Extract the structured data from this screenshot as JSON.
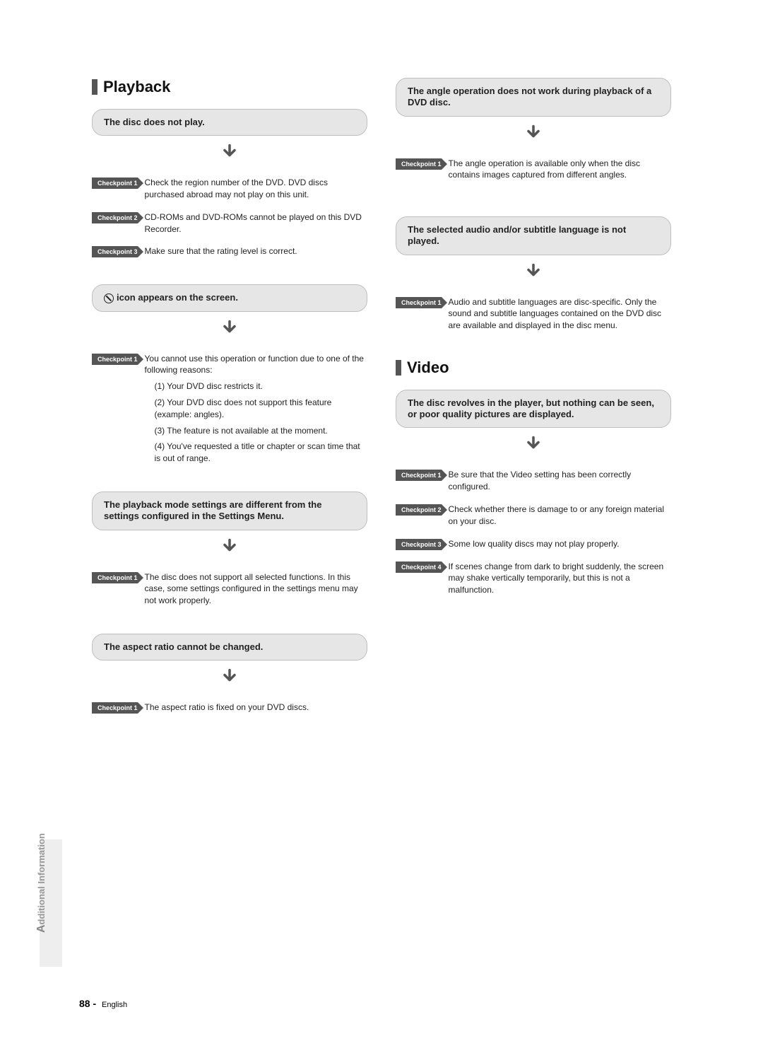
{
  "page_number": "88",
  "footer_language": "English",
  "sidebar_label_main": "dditional Information",
  "sidebar_label_cap": "A",
  "sections": {
    "playback": {
      "title": "Playback",
      "blocks": [
        {
          "key": "p1",
          "heading": "The disc does not play.",
          "checks": [
            {
              "label": "Checkpoint 1",
              "text": "Check the region number of the DVD. DVD discs purchased abroad may not play on this unit."
            },
            {
              "label": "Checkpoint 2",
              "text": "CD-ROMs and DVD-ROMs cannot be played on this DVD Recorder."
            },
            {
              "label": "Checkpoint 3",
              "text": "Make sure that the rating level is correct."
            }
          ]
        },
        {
          "key": "p2",
          "heading_icon": "prohibit",
          "heading": "icon appears on the screen.",
          "checks": [
            {
              "label": "Checkpoint 1",
              "text": "You cannot use this operation or function due to one of the following reasons:",
              "subs": [
                "(1) Your DVD disc restricts it.",
                "(2) Your DVD disc does not support this feature (example: angles).",
                "(3) The feature is not available at the moment.",
                "(4) You've requested a title or chapter or scan time that is out of range."
              ]
            }
          ]
        },
        {
          "key": "p3",
          "heading": "The playback mode settings are different from the settings configured in the Settings Menu.",
          "checks": [
            {
              "label": "Checkpoint 1",
              "text": "The disc does not support all selected functions. In this case, some settings configured in the settings menu may not work properly."
            }
          ]
        },
        {
          "key": "p4",
          "heading": "The aspect ratio cannot be changed.",
          "checks": [
            {
              "label": "Checkpoint 1",
              "text": "The aspect ratio is fixed on your DVD discs."
            }
          ]
        },
        {
          "key": "p5",
          "heading": "The angle operation does not work during playback of a DVD disc.",
          "checks": [
            {
              "label": "Checkpoint 1",
              "text": "The angle operation is available only when the disc contains images captured from different angles."
            }
          ]
        },
        {
          "key": "p6",
          "heading": "The selected audio and/or subtitle language is not played.",
          "checks": [
            {
              "label": "Checkpoint 1",
              "text": "Audio and subtitle languages are disc-specific. Only the sound and subtitle languages contained on the DVD disc are available and displayed in the disc menu."
            }
          ]
        }
      ]
    },
    "video": {
      "title": "Video",
      "blocks": [
        {
          "key": "v1",
          "heading": "The disc revolves in the player, but nothing can be seen, or poor quality pictures are displayed.",
          "checks": [
            {
              "label": "Checkpoint 1",
              "text": "Be sure that the Video setting has been correctly configured."
            },
            {
              "label": "Checkpoint 2",
              "text": "Check whether there is damage to or any foreign material on your disc."
            },
            {
              "label": "Checkpoint 3",
              "text": "Some low quality discs may not play properly."
            },
            {
              "label": "Checkpoint 4",
              "text": "If scenes change from dark to bright suddenly, the screen may shake vertically temporarily, but this is not a malfunction."
            }
          ]
        }
      ]
    }
  }
}
